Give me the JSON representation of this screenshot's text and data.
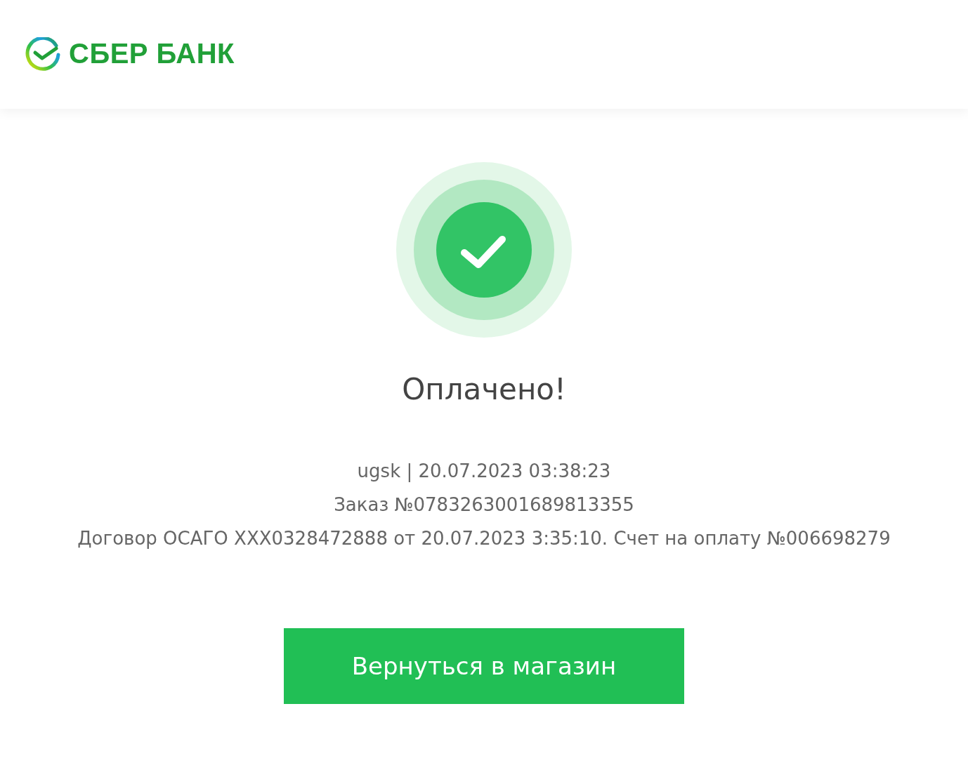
{
  "header": {
    "logo_text": "СБЕР БАНК"
  },
  "result": {
    "kind": "success",
    "title": "Оплачено!",
    "details": [
      "ugsk | 20.07.2023 03:38:23",
      "Заказ №0783263001689813355",
      "Договор ОСАГО XXX0328472888 от 20.07.2023 3:35:10. Счет на оплату №006698279"
    ]
  },
  "button": {
    "label": "Вернуться в магазин"
  }
}
